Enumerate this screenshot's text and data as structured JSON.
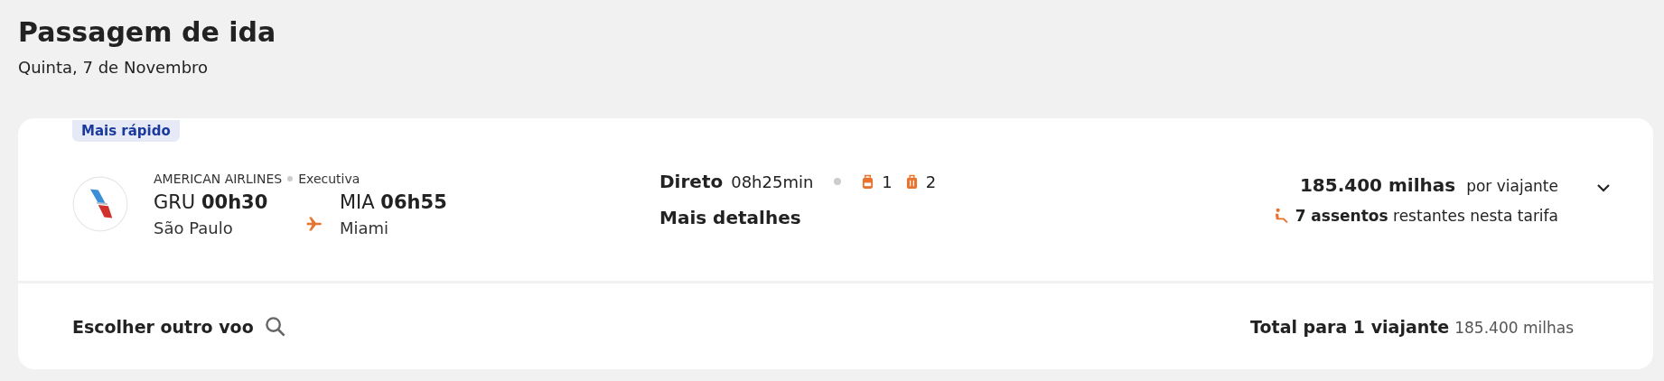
{
  "header": {
    "title": "Passagem de ida",
    "date": "Quinta, 7 de Novembro"
  },
  "flight": {
    "badge": "Mais rápido",
    "airline": "AMERICAN AIRLINES",
    "cabin": "Executiva",
    "origin": {
      "code": "GRU",
      "time": "00h30",
      "city": "São Paulo"
    },
    "destination": {
      "code": "MIA",
      "time": "06h55",
      "city": "Miami"
    },
    "stops": "Direto",
    "duration": "08h25min",
    "carry_on": "1",
    "checked_bags": "2",
    "details_link": "Mais detalhes",
    "price": "185.400 milhas",
    "price_note": "por viajante",
    "seats_count": "7 assentos",
    "seats_note": "restantes nesta tarifa",
    "expanded": false
  },
  "footer": {
    "change_flight": "Escolher outro voo",
    "total_label": "Total para 1 viajante",
    "total_value": "185.400 milhas"
  }
}
